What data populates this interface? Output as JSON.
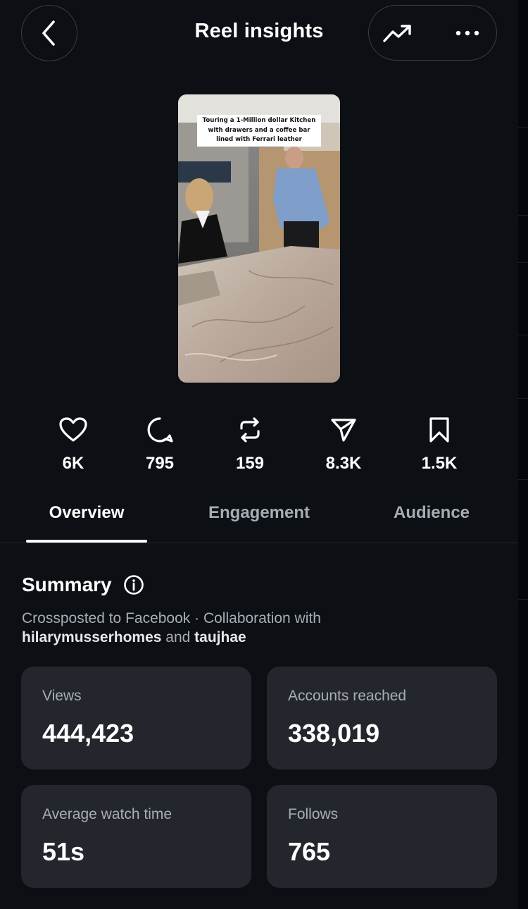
{
  "header": {
    "title": "Reel insights"
  },
  "reel": {
    "caption": "Touring a 1-Million dollar Kitchen with drawers and a coffee bar lined with Ferrari leather"
  },
  "stats": [
    {
      "icon": "heart-icon",
      "value": "6K"
    },
    {
      "icon": "comment-icon",
      "value": "795"
    },
    {
      "icon": "repost-icon",
      "value": "159"
    },
    {
      "icon": "share-icon",
      "value": "8.3K"
    },
    {
      "icon": "save-icon",
      "value": "1.5K"
    }
  ],
  "tabs": [
    {
      "label": "Overview",
      "active": true
    },
    {
      "label": "Engagement",
      "active": false
    },
    {
      "label": "Audience",
      "active": false
    }
  ],
  "summary": {
    "title": "Summary",
    "desc_prefix": "Crossposted to Facebook · Collaboration with",
    "collaborator_1": "hilarymusserhomes",
    "joiner": "and",
    "collaborator_2": "taujhae"
  },
  "metrics": [
    {
      "label": "Views",
      "value": "444,423"
    },
    {
      "label": "Accounts reached",
      "value": "338,019"
    },
    {
      "label": "Average watch time",
      "value": "51s"
    },
    {
      "label": "Follows",
      "value": "765"
    }
  ],
  "colors": {
    "background": "#0c0f14",
    "card": "#23262c",
    "muted_text": "#a9adb5"
  }
}
